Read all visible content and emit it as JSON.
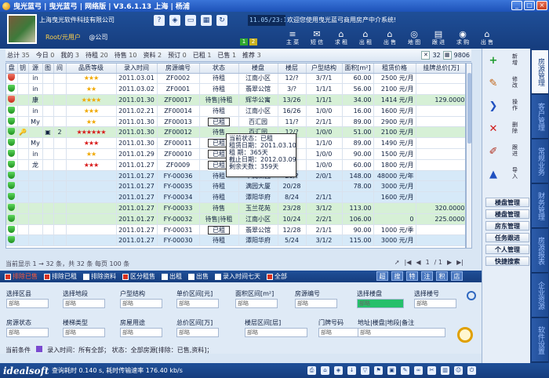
{
  "window": {
    "title": "曳光蓝弓 | 曳光蓝弓 | 网络版 | V3.6.1.13 上海 | 杨浦",
    "min": "_",
    "max": "□",
    "close": "×"
  },
  "header": {
    "company": "上海曳光软件科技有限公司",
    "user": "Root/元用户",
    "user_company": "@公司",
    "clock": "11.05/23:13",
    "ticker": "欢迎您使用曳光蓝弓商用房产中介系统!",
    "pages": [
      "1",
      "2"
    ],
    "modules": [
      {
        "label": "主 菜",
        "icon": "≡"
      },
      {
        "label": "短 信",
        "icon": "✉"
      },
      {
        "label": "求 租",
        "icon": "⌂"
      },
      {
        "label": "出 租",
        "icon": "⌂"
      },
      {
        "label": "出 售",
        "icon": "⌂"
      },
      {
        "label": "地 图",
        "icon": "◎"
      },
      {
        "label": "跟 进",
        "icon": "▤"
      },
      {
        "label": "求 购",
        "icon": "◉"
      },
      {
        "label": "出 售",
        "icon": "⌂"
      }
    ]
  },
  "toolbar": {
    "counts": [
      {
        "label": "总计",
        "value": "35"
      },
      {
        "label": "今日",
        "value": "0"
      },
      {
        "label": "我的",
        "value": "3"
      },
      {
        "label": "待租",
        "value": "20"
      },
      {
        "label": "待售",
        "value": "10"
      },
      {
        "label": "资料",
        "value": "2"
      },
      {
        "label": "预订",
        "value": "0"
      },
      {
        "label": "已租",
        "value": "1"
      },
      {
        "label": "已售",
        "value": "1"
      },
      {
        "label": "推荐",
        "value": "3"
      }
    ],
    "right_a": "32",
    "right_b": "9806"
  },
  "table": {
    "columns": [
      "盘",
      "钥",
      "源",
      "图",
      "间",
      "品质等级",
      "录入时间",
      "房源编号",
      "状态",
      "楼盘",
      "楼层",
      "户型结构",
      "面积[m²]",
      "租赁价格",
      "挂牌总价[万]"
    ],
    "rows": [
      {
        "cls": "",
        "mark": "red",
        "key": "",
        "src": "in",
        "pic": "",
        "rm": "",
        "stars": "★★★",
        "sc": "",
        "date": "2011.03.01",
        "code": "ZF0002",
        "status": "待租",
        "boxed": false,
        "bld": "江南小区",
        "floor": "12/?",
        "type": "3/7/1",
        "area": "60.00",
        "rent": "2500 元/月",
        "total": ""
      },
      {
        "cls": "",
        "mark": "",
        "key": "",
        "src": "in",
        "pic": "",
        "rm": "",
        "stars": "★★",
        "sc": "",
        "date": "2011.03.02",
        "code": "ZF0001",
        "status": "待租",
        "boxed": false,
        "bld": "翡翠公馆",
        "floor": "3/?",
        "type": "1/1/1",
        "area": "56.00",
        "rent": "2100 元/月",
        "total": ""
      },
      {
        "cls": "grn",
        "mark": "red",
        "key": "",
        "src": "康",
        "pic": "",
        "rm": "",
        "stars": "★★★★",
        "sc": "",
        "date": "2011.01.30",
        "code": "ZF00017",
        "status": "待售|待租",
        "boxed": false,
        "bld": "辉华公寓",
        "floor": "13/26",
        "type": "1/1/1",
        "area": "34.00",
        "rent": "1414 元/月",
        "total": "129.0000"
      },
      {
        "cls": "",
        "mark": "",
        "key": "",
        "src": "in",
        "pic": "",
        "rm": "",
        "stars": "★★★",
        "sc": "",
        "date": "2011.02.21",
        "code": "ZF00014",
        "status": "待租",
        "boxed": false,
        "bld": "江南小区",
        "floor": "16/26",
        "type": "1/0/0",
        "area": "16.00",
        "rent": "1600 元/月",
        "total": ""
      },
      {
        "cls": "",
        "mark": "",
        "key": "",
        "src": "My",
        "pic": "",
        "rm": "",
        "stars": "★★",
        "sc": "",
        "date": "2011.01.30",
        "code": "ZF00013",
        "status": "已租",
        "boxed": true,
        "bld": "百汇园",
        "floor": "11/?",
        "type": "2/1/1",
        "area": "89.00",
        "rent": "2900 元/月",
        "total": ""
      },
      {
        "cls": "grn",
        "mark": "",
        "key": "🔑",
        "src": "",
        "pic": "▣",
        "rm": "2",
        "stars": "★★★★★★",
        "sc": "red",
        "date": "2011.01.30",
        "code": "ZF00012",
        "status": "待售",
        "boxed": false,
        "bld": "百汇园",
        "floor": "12/?",
        "type": "1/0/0",
        "area": "51.00",
        "rent": "2100 元/月",
        "total": ""
      },
      {
        "cls": "",
        "mark": "",
        "key": "",
        "src": "My",
        "pic": "",
        "rm": "",
        "stars": "★★★",
        "sc": "red",
        "date": "2011.01.30",
        "code": "ZF00011",
        "status": "已租",
        "boxed": true,
        "bld": "",
        "floor": "",
        "type": "1/1/0",
        "area": "89.00",
        "rent": "1490 元/月",
        "total": ""
      },
      {
        "cls": "",
        "mark": "",
        "key": "",
        "src": "in",
        "pic": "",
        "rm": "",
        "stars": "★★",
        "sc": "",
        "date": "2011.01.29",
        "code": "ZF00010",
        "status": "已租",
        "boxed": true,
        "bld": "",
        "floor": "",
        "type": "1/0/0",
        "area": "90.00",
        "rent": "1500 元/月",
        "total": ""
      },
      {
        "cls": "",
        "mark": "",
        "key": "",
        "src": "龙",
        "pic": "",
        "rm": "",
        "stars": "★★★",
        "sc": "red",
        "date": "2011.01.27",
        "code": "ZF0009",
        "status": "已租",
        "boxed": true,
        "bld": "",
        "floor": "",
        "type": "1/0/0",
        "area": "60.00",
        "rent": "1800 元/月",
        "total": ""
      },
      {
        "cls": "alt",
        "mark": "",
        "key": "",
        "src": "",
        "pic": "",
        "rm": "",
        "stars": "",
        "sc": "",
        "date": "2011.01.27",
        "code": "FY-00036",
        "status": "待租",
        "boxed": false,
        "bld": "华润新园",
        "floor": "20/?",
        "type": "2/0/1",
        "area": "148.00",
        "rent": "48000 元/年",
        "total": ""
      },
      {
        "cls": "alt",
        "mark": "",
        "key": "",
        "src": "",
        "pic": "",
        "rm": "",
        "stars": "",
        "sc": "",
        "date": "2011.01.27",
        "code": "FY-00035",
        "status": "待租",
        "boxed": false,
        "bld": "满园大厦",
        "floor": "20/28",
        "type": "",
        "area": "78.00",
        "rent": "3000 元/月",
        "total": ""
      },
      {
        "cls": "alt",
        "mark": "",
        "key": "",
        "src": "",
        "pic": "",
        "rm": "",
        "stars": "",
        "sc": "",
        "date": "2011.01.27",
        "code": "FY-00034",
        "status": "待租",
        "boxed": false,
        "bld": "潭阳华府",
        "floor": "8/24",
        "type": "2/1/1",
        "area": "",
        "rent": "1600 元/月",
        "total": ""
      },
      {
        "cls": "grn",
        "mark": "",
        "key": "",
        "src": "",
        "pic": "",
        "rm": "",
        "stars": "",
        "sc": "",
        "date": "2011.01.27",
        "code": "FY-00033",
        "status": "待售",
        "boxed": false,
        "bld": "玉兰花苑",
        "floor": "23/28",
        "type": "3/1/2",
        "area": "113.00",
        "rent": "",
        "total": "320.0000"
      },
      {
        "cls": "grn",
        "mark": "",
        "key": "",
        "src": "",
        "pic": "",
        "rm": "",
        "stars": "",
        "sc": "",
        "date": "2011.01.27",
        "code": "FY-00032",
        "status": "待售|待租",
        "boxed": false,
        "bld": "江南小区",
        "floor": "10/24",
        "type": "2/2/1",
        "area": "106.00",
        "rent": "0",
        "total": "225.0000"
      },
      {
        "cls": "",
        "mark": "",
        "key": "",
        "src": "",
        "pic": "",
        "rm": "",
        "stars": "",
        "sc": "",
        "date": "2011.01.27",
        "code": "FY-00031",
        "status": "已租",
        "boxed": true,
        "bld": "翡翠公馆",
        "floor": "12/28",
        "type": "2/1/1",
        "area": "90.00",
        "rent": "1000 元/季",
        "total": ""
      },
      {
        "cls": "alt",
        "mark": "",
        "key": "",
        "src": "",
        "pic": "",
        "rm": "",
        "stars": "",
        "sc": "",
        "date": "2011.01.27",
        "code": "FY-00030",
        "status": "待租",
        "boxed": false,
        "bld": "潭阳华府",
        "floor": "5/24",
        "type": "3/1/2",
        "area": "115.00",
        "rent": "3000 元/月",
        "total": ""
      }
    ]
  },
  "tooltip": [
    "当前状态：已租",
    "租赁日期：2011.03.10",
    "租    期：365天",
    "截止日期：2012.03.09",
    "剩余天数：359天"
  ],
  "pagebar": {
    "info": "当前显示 1 → 32 条，共 32 条 每页 100 条",
    "page": "1",
    "of": "/ 1"
  },
  "filterbar": {
    "options": [
      {
        "label": "排除已售",
        "on": true,
        "hot": true
      },
      {
        "label": "排除已租",
        "on": true,
        "hot": false
      },
      {
        "label": "排除资料",
        "on": false,
        "hot": false
      },
      {
        "label": "区分租售",
        "on": true,
        "hot": false
      },
      {
        "label": "出租",
        "on": false,
        "hot": false
      },
      {
        "label": "出售",
        "on": false,
        "hot": false
      },
      {
        "label": "录入时间七天",
        "on": false,
        "hot": false
      },
      {
        "label": "全部",
        "on": true,
        "hot": false
      }
    ],
    "quick": [
      "超",
      "搜",
      "特",
      "注",
      "积",
      "店"
    ]
  },
  "search": {
    "row1": [
      "选择区县",
      "选择地段",
      "户型结构",
      "单价区间[元]",
      "面积区间[m²]",
      "房源编号",
      "选择楼盘",
      "选择楼号"
    ],
    "row2": [
      "房源状态",
      "楼梯类型",
      "房屋用途",
      "总价区间[万]",
      "楼层区间[层]",
      "门牌号码",
      "地址|楼盘|地段|备注"
    ],
    "placeholder": "部略"
  },
  "condition": {
    "label": "当前条件",
    "text": "录入时间：所有全部； 状态：全部房源[排除：已售,资料]；"
  },
  "bottombar": {
    "brand": "idealsoft",
    "status": "查询耗时 0.140 s, 耗时传输速率 176.40 kb/s"
  },
  "rightpanel": {
    "actions": [
      {
        "label": "新增",
        "icon": "+",
        "color": "#1a9a2a"
      },
      {
        "label": "修改",
        "icon": "✎",
        "color": "#c06010"
      },
      {
        "label": "操作",
        "icon": "❯",
        "color": "#2050c0"
      },
      {
        "label": "删除",
        "icon": "✕",
        "color": "#d01a1a"
      },
      {
        "label": "跟进",
        "icon": "✐",
        "color": "#b03020"
      },
      {
        "label": "导入",
        "icon": "▲",
        "color": "#2050c0"
      }
    ],
    "links": [
      "楼盘管理",
      "楼盘管理",
      "房东管理",
      "任务跟进",
      "个人管理",
      "快捷搜索"
    ]
  },
  "vtabs": [
    {
      "label": "房源管理",
      "on": true
    },
    {
      "label": "客户管理",
      "on": false
    },
    {
      "label": "常规业务",
      "on": false
    },
    {
      "label": "财务管理",
      "on": false
    },
    {
      "label": "房源报表",
      "on": false
    },
    {
      "label": "企业资源",
      "on": false
    },
    {
      "label": "软件设置",
      "on": false
    }
  ]
}
